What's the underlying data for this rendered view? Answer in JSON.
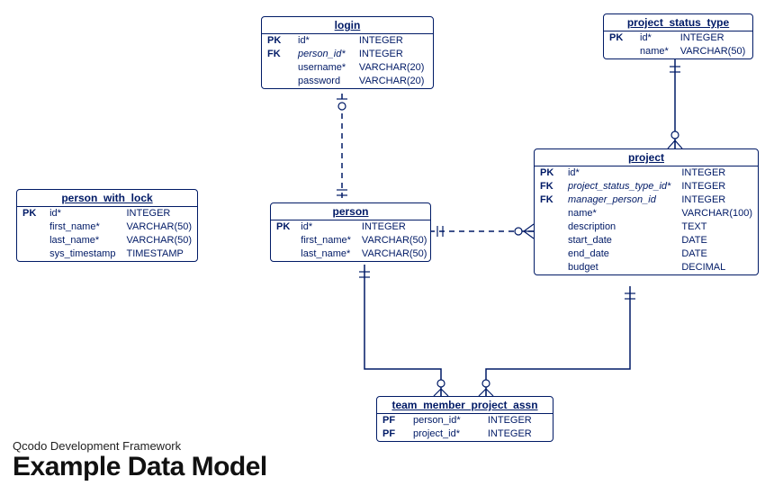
{
  "footer": {
    "subtitle": "Qcodo Development Framework",
    "title": "Example Data Model"
  },
  "entities": {
    "login": {
      "name": "login",
      "columns": [
        {
          "key": "PK",
          "name": "id*",
          "type": "INTEGER",
          "cls": "pk"
        },
        {
          "key": "FK",
          "name": "person_id*",
          "type": "INTEGER",
          "cls": "fk"
        },
        {
          "key": "",
          "name": "username*",
          "type": "VARCHAR(20)",
          "cls": ""
        },
        {
          "key": "",
          "name": "password",
          "type": "VARCHAR(20)",
          "cls": ""
        }
      ]
    },
    "project_status_type": {
      "name": "project_status_type",
      "columns": [
        {
          "key": "PK",
          "name": "id*",
          "type": "INTEGER",
          "cls": "pk"
        },
        {
          "key": "",
          "name": "name*",
          "type": "VARCHAR(50)",
          "cls": ""
        }
      ]
    },
    "person_with_lock": {
      "name": "person_with_lock",
      "columns": [
        {
          "key": "PK",
          "name": "id*",
          "type": "INTEGER",
          "cls": "pk"
        },
        {
          "key": "",
          "name": "first_name*",
          "type": "VARCHAR(50)",
          "cls": ""
        },
        {
          "key": "",
          "name": "last_name*",
          "type": "VARCHAR(50)",
          "cls": ""
        },
        {
          "key": "",
          "name": "sys_timestamp",
          "type": "TIMESTAMP",
          "cls": ""
        }
      ]
    },
    "person": {
      "name": "person",
      "columns": [
        {
          "key": "PK",
          "name": "id*",
          "type": "INTEGER",
          "cls": "pk"
        },
        {
          "key": "",
          "name": "first_name*",
          "type": "VARCHAR(50)",
          "cls": ""
        },
        {
          "key": "",
          "name": "last_name*",
          "type": "VARCHAR(50)",
          "cls": ""
        }
      ]
    },
    "project": {
      "name": "project",
      "columns": [
        {
          "key": "PK",
          "name": "id*",
          "type": "INTEGER",
          "cls": "pk"
        },
        {
          "key": "FK",
          "name": "project_status_type_id*",
          "type": "INTEGER",
          "cls": "fk"
        },
        {
          "key": "FK",
          "name": "manager_person_id",
          "type": "INTEGER",
          "cls": "fk"
        },
        {
          "key": "",
          "name": "name*",
          "type": "VARCHAR(100)",
          "cls": ""
        },
        {
          "key": "",
          "name": "description",
          "type": "TEXT",
          "cls": ""
        },
        {
          "key": "",
          "name": "start_date",
          "type": "DATE",
          "cls": ""
        },
        {
          "key": "",
          "name": "end_date",
          "type": "DATE",
          "cls": ""
        },
        {
          "key": "",
          "name": "budget",
          "type": "DECIMAL",
          "cls": ""
        }
      ]
    },
    "team_member_project_assn": {
      "name": "team_member_project_assn",
      "columns": [
        {
          "key": "PF",
          "name": "person_id*",
          "type": "INTEGER",
          "cls": "pk"
        },
        {
          "key": "PF",
          "name": "project_id*",
          "type": "INTEGER",
          "cls": "pk"
        }
      ]
    }
  },
  "chart_data": {
    "type": "er-diagram",
    "entities": [
      {
        "name": "login",
        "columns": [
          "PK id* INTEGER",
          "FK person_id* INTEGER",
          "username* VARCHAR(20)",
          "password VARCHAR(20)"
        ]
      },
      {
        "name": "project_status_type",
        "columns": [
          "PK id* INTEGER",
          "name* VARCHAR(50)"
        ]
      },
      {
        "name": "person_with_lock",
        "columns": [
          "PK id* INTEGER",
          "first_name* VARCHAR(50)",
          "last_name* VARCHAR(50)",
          "sys_timestamp TIMESTAMP"
        ]
      },
      {
        "name": "person",
        "columns": [
          "PK id* INTEGER",
          "first_name* VARCHAR(50)",
          "last_name* VARCHAR(50)"
        ]
      },
      {
        "name": "project",
        "columns": [
          "PK id* INTEGER",
          "FK project_status_type_id* INTEGER",
          "FK manager_person_id INTEGER",
          "name* VARCHAR(100)",
          "description TEXT",
          "start_date DATE",
          "end_date DATE",
          "budget DECIMAL"
        ]
      },
      {
        "name": "team_member_project_assn",
        "columns": [
          "PF person_id* INTEGER",
          "PF project_id* INTEGER"
        ]
      }
    ],
    "relationships": [
      {
        "from": "login",
        "to": "person",
        "from_card": "0..1",
        "to_card": "1",
        "optional": true
      },
      {
        "from": "project",
        "to": "project_status_type",
        "from_card": "0..*",
        "to_card": "1",
        "optional": false
      },
      {
        "from": "project",
        "to": "person",
        "from_card": "0..*",
        "to_card": "1",
        "optional": true,
        "role": "manager_person_id"
      },
      {
        "from": "team_member_project_assn",
        "to": "person",
        "from_card": "0..*",
        "to_card": "1",
        "optional": false
      },
      {
        "from": "team_member_project_assn",
        "to": "project",
        "from_card": "0..*",
        "to_card": "1",
        "optional": false
      }
    ]
  }
}
